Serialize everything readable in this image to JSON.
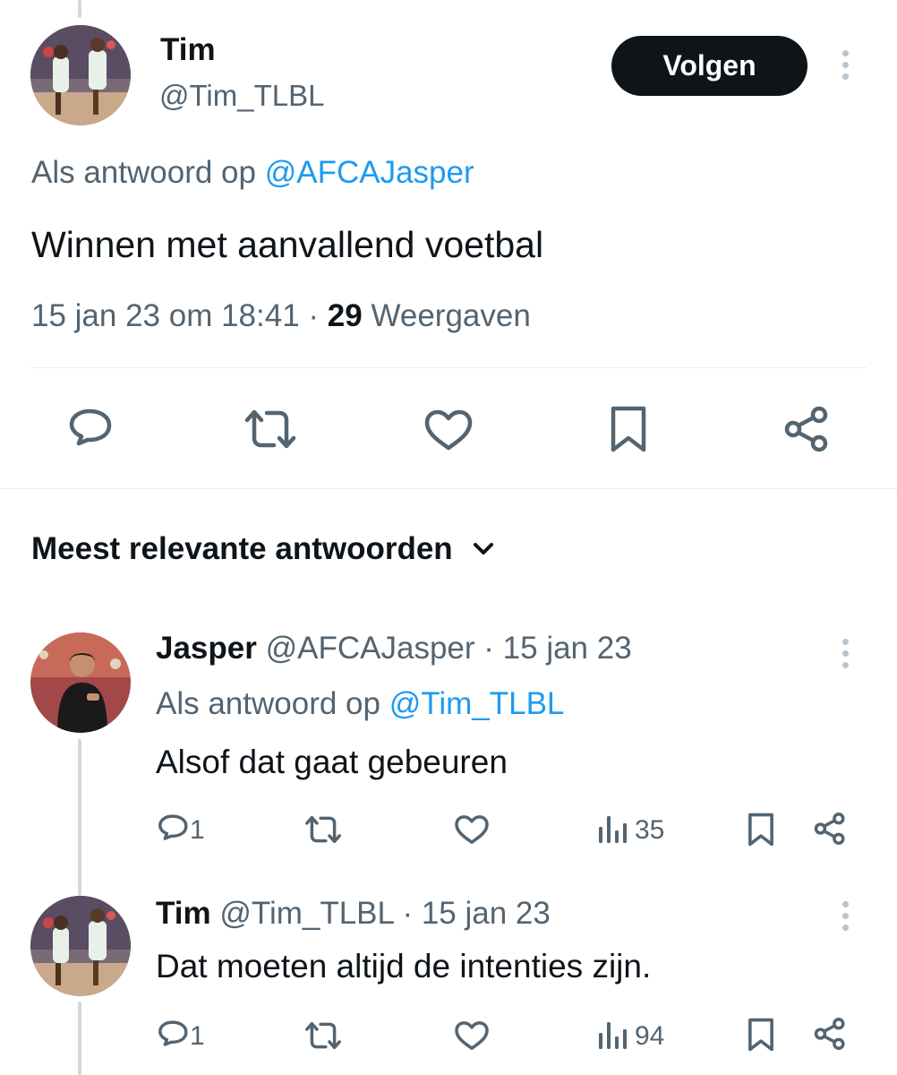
{
  "main_tweet": {
    "name": "Tim",
    "handle": "@Tim_TLBL",
    "follow_label": "Volgen",
    "reply_prefix": "Als antwoord op",
    "reply_to": "@AFCAJasper",
    "text": "Winnen met aanvallend voetbal",
    "timestamp": "15 jan 23 om 18:41",
    "separator": "·",
    "views_count": "29",
    "views_label": "Weergaven"
  },
  "sort": {
    "label": "Meest relevante antwoorden"
  },
  "replies": [
    {
      "name": "Jasper",
      "handle": "@AFCAJasper",
      "date": "· 15 jan 23",
      "reply_prefix": "Als antwoord op",
      "reply_to": "@Tim_TLBL",
      "text": "Alsof dat gaat gebeuren",
      "reply_count": "1",
      "views": "35"
    },
    {
      "name": "Tim",
      "handle": "@Tim_TLBL",
      "date": "· 15 jan 23",
      "text": "Dat moeten altijd de intenties zijn.",
      "reply_count": "1",
      "views": "94"
    }
  ],
  "icons": [
    "reply-icon",
    "retweet-icon",
    "like-icon",
    "bookmark-icon",
    "share-icon",
    "views-icon",
    "more-icon",
    "chevron-down-icon"
  ],
  "colors": {
    "text": "#0f1419",
    "secondary": "#536471",
    "link": "#1d9bf0",
    "follow_bg": "#0f1419"
  }
}
